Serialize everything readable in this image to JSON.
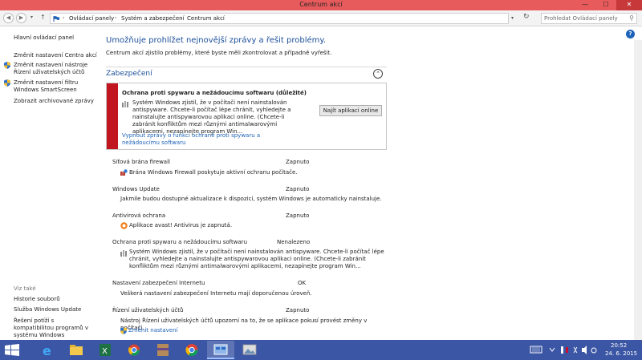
{
  "window": {
    "title": "Centrum akcí",
    "min": "—",
    "max": "☐",
    "close": "✕"
  },
  "address": {
    "crumbs": [
      "Ovládací panely",
      "Systém a zabezpečení",
      "Centrum akcí"
    ],
    "search_placeholder": "Prohledat Ovládací panely"
  },
  "sidebar": {
    "items": [
      {
        "label": "Hlavní ovládací panel",
        "shield": false
      },
      {
        "label": "Změnit nastavení Centra akcí",
        "shield": false
      },
      {
        "label": "Změnit nastavení nástroje Řízení uživatelských účtů",
        "shield": true
      },
      {
        "label": "Změnit nastavení filtru Windows SmartScreen",
        "shield": true
      },
      {
        "label": "Zobrazit archivované zprávy",
        "shield": false
      }
    ],
    "see_also_title": "Viz také",
    "see_also": [
      "Historie souborů",
      "Služba Windows Update",
      "Řešení potíží s kompatibilitou programů v systému Windows"
    ]
  },
  "main": {
    "heading": "Umožňuje prohlížet nejnovější zprávy a řešit problémy.",
    "subheading": "Centrum akcí zjistilo problémy, které byste měli zkontrolovat a případně vyřešit.",
    "section_title": "Zabezpečení",
    "alert": {
      "title": "Ochrana proti spywaru a nežádoucímu softwaru (důležité)",
      "text": "Systém Windows zjistil, že v počítači není nainstalován antispyware. Chcete-li počítač lépe chránit, vyhledejte a nainstalujte antispywarovou aplikaci online. (Chcete-li zabránit konfliktům mezi různými antimalwarovými aplikacemi, nezapínejte program Win...",
      "button": "Najít aplikaci online",
      "link": "Vypnout zprávy o funkci ochrané proti spywaru a nežádoucímu softwaru"
    },
    "items": [
      {
        "name": "Síťová brána firewall",
        "status": "Zapnuto",
        "desc": "Brána Windows Firewall poskytuje aktivní ochranu počítače."
      },
      {
        "name": "Windows Update",
        "status": "Zapnuto",
        "desc": "Jakmile budou dostupné aktualizace k dispozici, systém Windows je automaticky nainstaluje."
      },
      {
        "name": "Antivirová ochrana",
        "status": "Zapnuto",
        "desc": "Aplikace avast! Antivirus je zapnutá."
      },
      {
        "name": "Ochrana proti spywaru a nežádoucímu softwaru",
        "status": "Nenalezeno",
        "desc": "Systém Windows zjistil, že v počítači není nainstalován antispyware. Chcete-li počítač lépe chránit, vyhledejte a nainstalujte antispywarovou aplikaci online. (Chcete-li zabránit konfliktům mezi různými antimalwarovými aplikacemi, nezapínejte program Win..."
      },
      {
        "name": "Nastavení zabezpečení Internetu",
        "status": "OK",
        "desc": "Veškerá nastavení zabezpečení Internetu mají doporučenou úroveň."
      },
      {
        "name": "Řízení uživatelských účtů",
        "status": "Zapnuto",
        "desc": "Nástroj Řízení uživatelských účtů upozorní na to, že se aplikace pokusí provést změny v počítači."
      }
    ],
    "change_settings": "Změnit nastavení"
  },
  "taskbar": {
    "apps": [
      "internet-explorer",
      "file-explorer",
      "excel",
      "chrome-old",
      "winrar",
      "chrome",
      "control-panel",
      "photos"
    ],
    "time": "20:52",
    "date": "24. 6. 2015"
  },
  "colors": {
    "title_bar": "#e85b5c",
    "accent": "#1c4f99",
    "link": "#1c62b8",
    "alert": "#c1151f",
    "taskbar": "#3b56a4"
  }
}
